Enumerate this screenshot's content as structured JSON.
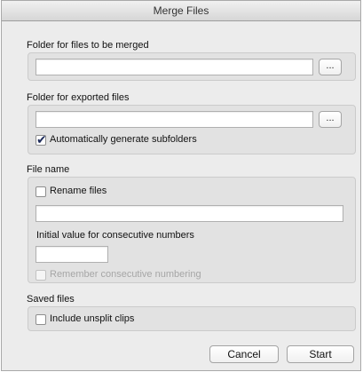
{
  "window": {
    "title": "Merge Files"
  },
  "merge_folder": {
    "label": "Folder for files to be merged",
    "value": "",
    "browse_label": "..."
  },
  "export_folder": {
    "label": "Folder for exported files",
    "value": "",
    "browse_label": "...",
    "auto_subfolders": {
      "label": "Automatically generate subfolders",
      "checked": true
    }
  },
  "file_name": {
    "label": "File name",
    "rename": {
      "label": "Rename files",
      "checked": false
    },
    "rename_value": "",
    "initial_value_label": "Initial value for consecutive numbers",
    "initial_value": "",
    "remember": {
      "label": "Remember consecutive numbering",
      "checked": false,
      "disabled": true
    }
  },
  "saved_files": {
    "label": "Saved files",
    "include_unsplit": {
      "label": "Include unsplit clips",
      "checked": false
    }
  },
  "buttons": {
    "cancel": "Cancel",
    "start": "Start"
  },
  "icons": {
    "checkmark": "checkmark-icon"
  }
}
